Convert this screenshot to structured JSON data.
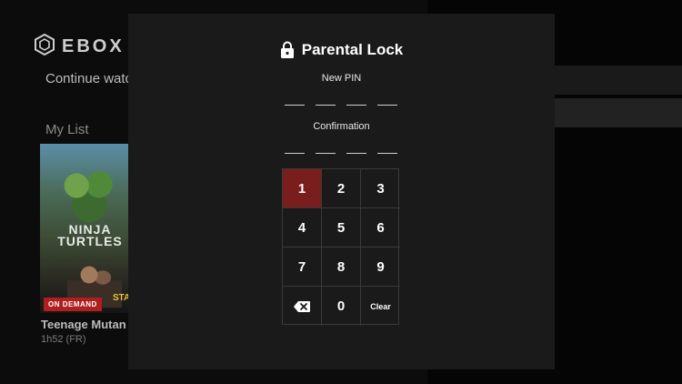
{
  "app": {
    "brand": "EBOX",
    "rows": {
      "continue_watching": "Continue watch",
      "my_list": "My List"
    },
    "poster": {
      "title_art": "NINJA TURTLES",
      "badge": "ON DEMAND",
      "tag": "STA",
      "title": "Teenage Mutan",
      "meta": "1h52 (FR)"
    }
  },
  "modal": {
    "title": "Parental Lock",
    "lock_icon": "lock-icon",
    "new_pin_label": "New PIN",
    "confirmation_label": "Confirmation",
    "pin_length": 4,
    "keys": [
      "1",
      "2",
      "3",
      "4",
      "5",
      "6",
      "7",
      "8",
      "9",
      "",
      "0",
      "Clear"
    ],
    "backspace_icon": "backspace-icon",
    "active_key": "1"
  },
  "colors": {
    "modal_bg": "#1a1a1a",
    "active_key": "#7a1d1d",
    "badge_red": "#b01e1e"
  }
}
